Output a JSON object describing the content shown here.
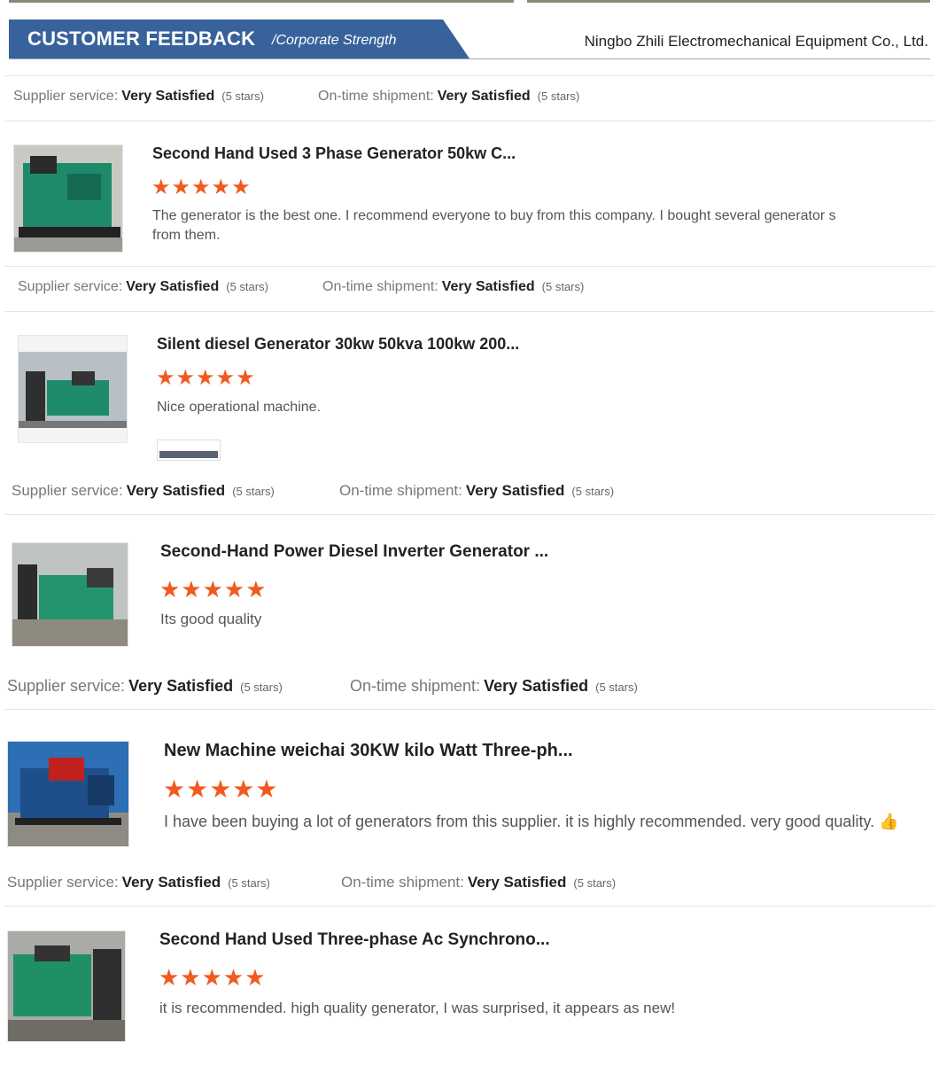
{
  "header": {
    "title": "CUSTOMER FEEDBACK",
    "subtitle": "/Corporate Strength",
    "company": "Ningbo Zhili Electromechanical Equipment Co., Ltd."
  },
  "colors": {
    "banner": "#37629b",
    "star": "#f15a1f"
  },
  "labels": {
    "supplier_service": "Supplier service:",
    "ontime_shipment": "On-time shipment:",
    "very_satisfied": "Very Satisfied",
    "five_stars": "(5 stars)",
    "star_glyphs": "★★★★★"
  },
  "reviews": [
    {
      "title": "Second Hand Used 3 Phase Generator 50kw C...",
      "rating": 5,
      "text": "The generator is the best one. I recommend everyone to buy from this company.  I bought several generator s from them.",
      "image_icon": "generator-photo"
    },
    {
      "title": "Silent diesel Generator 30kw 50kva 100kw 200...",
      "rating": 5,
      "text": "Nice operational machine.",
      "image_icon": "generator-photo"
    },
    {
      "title": "Second-Hand Power Diesel Inverter Generator ...",
      "rating": 5,
      "text": "Its good quality",
      "image_icon": "generator-photo"
    },
    {
      "title": "New Machine weichai 30KW kilo Watt Three-ph...",
      "rating": 5,
      "text": "I have been buying a lot of generators from this supplier. it is highly recommended. very good quality.",
      "emoji": "👍",
      "image_icon": "generator-photo"
    },
    {
      "title": "Second Hand Used Three-phase Ac Synchrono...",
      "rating": 5,
      "text": "it is recommended. high quality generator, I was surprised, it appears as new!",
      "image_icon": "generator-photo"
    }
  ]
}
